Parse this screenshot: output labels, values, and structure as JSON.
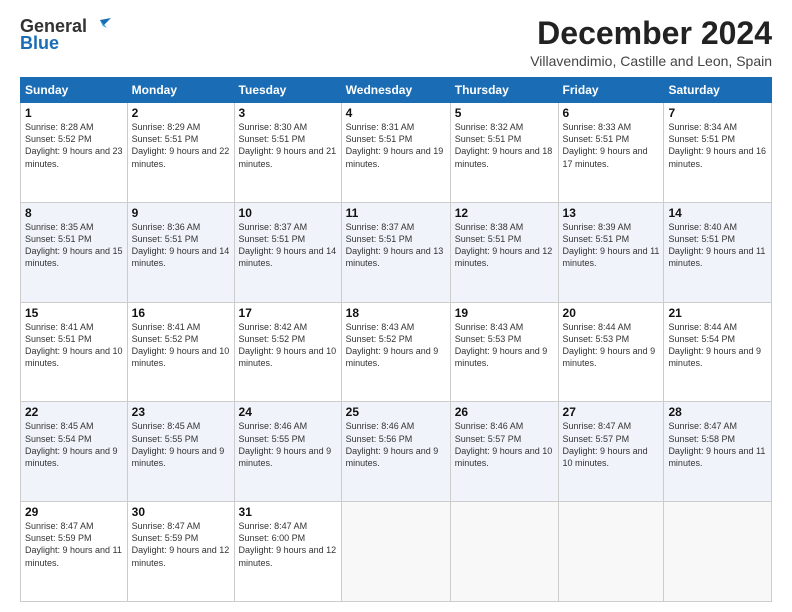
{
  "logo": {
    "general": "General",
    "blue": "Blue"
  },
  "header": {
    "month": "December 2024",
    "location": "Villavendimio, Castille and Leon, Spain"
  },
  "columns": [
    "Sunday",
    "Monday",
    "Tuesday",
    "Wednesday",
    "Thursday",
    "Friday",
    "Saturday"
  ],
  "weeks": [
    [
      {
        "day": "1",
        "sunrise": "Sunrise: 8:28 AM",
        "sunset": "Sunset: 5:52 PM",
        "daylight": "Daylight: 9 hours and 23 minutes."
      },
      {
        "day": "2",
        "sunrise": "Sunrise: 8:29 AM",
        "sunset": "Sunset: 5:51 PM",
        "daylight": "Daylight: 9 hours and 22 minutes."
      },
      {
        "day": "3",
        "sunrise": "Sunrise: 8:30 AM",
        "sunset": "Sunset: 5:51 PM",
        "daylight": "Daylight: 9 hours and 21 minutes."
      },
      {
        "day": "4",
        "sunrise": "Sunrise: 8:31 AM",
        "sunset": "Sunset: 5:51 PM",
        "daylight": "Daylight: 9 hours and 19 minutes."
      },
      {
        "day": "5",
        "sunrise": "Sunrise: 8:32 AM",
        "sunset": "Sunset: 5:51 PM",
        "daylight": "Daylight: 9 hours and 18 minutes."
      },
      {
        "day": "6",
        "sunrise": "Sunrise: 8:33 AM",
        "sunset": "Sunset: 5:51 PM",
        "daylight": "Daylight: 9 hours and 17 minutes."
      },
      {
        "day": "7",
        "sunrise": "Sunrise: 8:34 AM",
        "sunset": "Sunset: 5:51 PM",
        "daylight": "Daylight: 9 hours and 16 minutes."
      }
    ],
    [
      {
        "day": "8",
        "sunrise": "Sunrise: 8:35 AM",
        "sunset": "Sunset: 5:51 PM",
        "daylight": "Daylight: 9 hours and 15 minutes."
      },
      {
        "day": "9",
        "sunrise": "Sunrise: 8:36 AM",
        "sunset": "Sunset: 5:51 PM",
        "daylight": "Daylight: 9 hours and 14 minutes."
      },
      {
        "day": "10",
        "sunrise": "Sunrise: 8:37 AM",
        "sunset": "Sunset: 5:51 PM",
        "daylight": "Daylight: 9 hours and 14 minutes."
      },
      {
        "day": "11",
        "sunrise": "Sunrise: 8:37 AM",
        "sunset": "Sunset: 5:51 PM",
        "daylight": "Daylight: 9 hours and 13 minutes."
      },
      {
        "day": "12",
        "sunrise": "Sunrise: 8:38 AM",
        "sunset": "Sunset: 5:51 PM",
        "daylight": "Daylight: 9 hours and 12 minutes."
      },
      {
        "day": "13",
        "sunrise": "Sunrise: 8:39 AM",
        "sunset": "Sunset: 5:51 PM",
        "daylight": "Daylight: 9 hours and 11 minutes."
      },
      {
        "day": "14",
        "sunrise": "Sunrise: 8:40 AM",
        "sunset": "Sunset: 5:51 PM",
        "daylight": "Daylight: 9 hours and 11 minutes."
      }
    ],
    [
      {
        "day": "15",
        "sunrise": "Sunrise: 8:41 AM",
        "sunset": "Sunset: 5:51 PM",
        "daylight": "Daylight: 9 hours and 10 minutes."
      },
      {
        "day": "16",
        "sunrise": "Sunrise: 8:41 AM",
        "sunset": "Sunset: 5:52 PM",
        "daylight": "Daylight: 9 hours and 10 minutes."
      },
      {
        "day": "17",
        "sunrise": "Sunrise: 8:42 AM",
        "sunset": "Sunset: 5:52 PM",
        "daylight": "Daylight: 9 hours and 10 minutes."
      },
      {
        "day": "18",
        "sunrise": "Sunrise: 8:43 AM",
        "sunset": "Sunset: 5:52 PM",
        "daylight": "Daylight: 9 hours and 9 minutes."
      },
      {
        "day": "19",
        "sunrise": "Sunrise: 8:43 AM",
        "sunset": "Sunset: 5:53 PM",
        "daylight": "Daylight: 9 hours and 9 minutes."
      },
      {
        "day": "20",
        "sunrise": "Sunrise: 8:44 AM",
        "sunset": "Sunset: 5:53 PM",
        "daylight": "Daylight: 9 hours and 9 minutes."
      },
      {
        "day": "21",
        "sunrise": "Sunrise: 8:44 AM",
        "sunset": "Sunset: 5:54 PM",
        "daylight": "Daylight: 9 hours and 9 minutes."
      }
    ],
    [
      {
        "day": "22",
        "sunrise": "Sunrise: 8:45 AM",
        "sunset": "Sunset: 5:54 PM",
        "daylight": "Daylight: 9 hours and 9 minutes."
      },
      {
        "day": "23",
        "sunrise": "Sunrise: 8:45 AM",
        "sunset": "Sunset: 5:55 PM",
        "daylight": "Daylight: 9 hours and 9 minutes."
      },
      {
        "day": "24",
        "sunrise": "Sunrise: 8:46 AM",
        "sunset": "Sunset: 5:55 PM",
        "daylight": "Daylight: 9 hours and 9 minutes."
      },
      {
        "day": "25",
        "sunrise": "Sunrise: 8:46 AM",
        "sunset": "Sunset: 5:56 PM",
        "daylight": "Daylight: 9 hours and 9 minutes."
      },
      {
        "day": "26",
        "sunrise": "Sunrise: 8:46 AM",
        "sunset": "Sunset: 5:57 PM",
        "daylight": "Daylight: 9 hours and 10 minutes."
      },
      {
        "day": "27",
        "sunrise": "Sunrise: 8:47 AM",
        "sunset": "Sunset: 5:57 PM",
        "daylight": "Daylight: 9 hours and 10 minutes."
      },
      {
        "day": "28",
        "sunrise": "Sunrise: 8:47 AM",
        "sunset": "Sunset: 5:58 PM",
        "daylight": "Daylight: 9 hours and 11 minutes."
      }
    ],
    [
      {
        "day": "29",
        "sunrise": "Sunrise: 8:47 AM",
        "sunset": "Sunset: 5:59 PM",
        "daylight": "Daylight: 9 hours and 11 minutes."
      },
      {
        "day": "30",
        "sunrise": "Sunrise: 8:47 AM",
        "sunset": "Sunset: 5:59 PM",
        "daylight": "Daylight: 9 hours and 12 minutes."
      },
      {
        "day": "31",
        "sunrise": "Sunrise: 8:47 AM",
        "sunset": "Sunset: 6:00 PM",
        "daylight": "Daylight: 9 hours and 12 minutes."
      },
      null,
      null,
      null,
      null
    ]
  ]
}
